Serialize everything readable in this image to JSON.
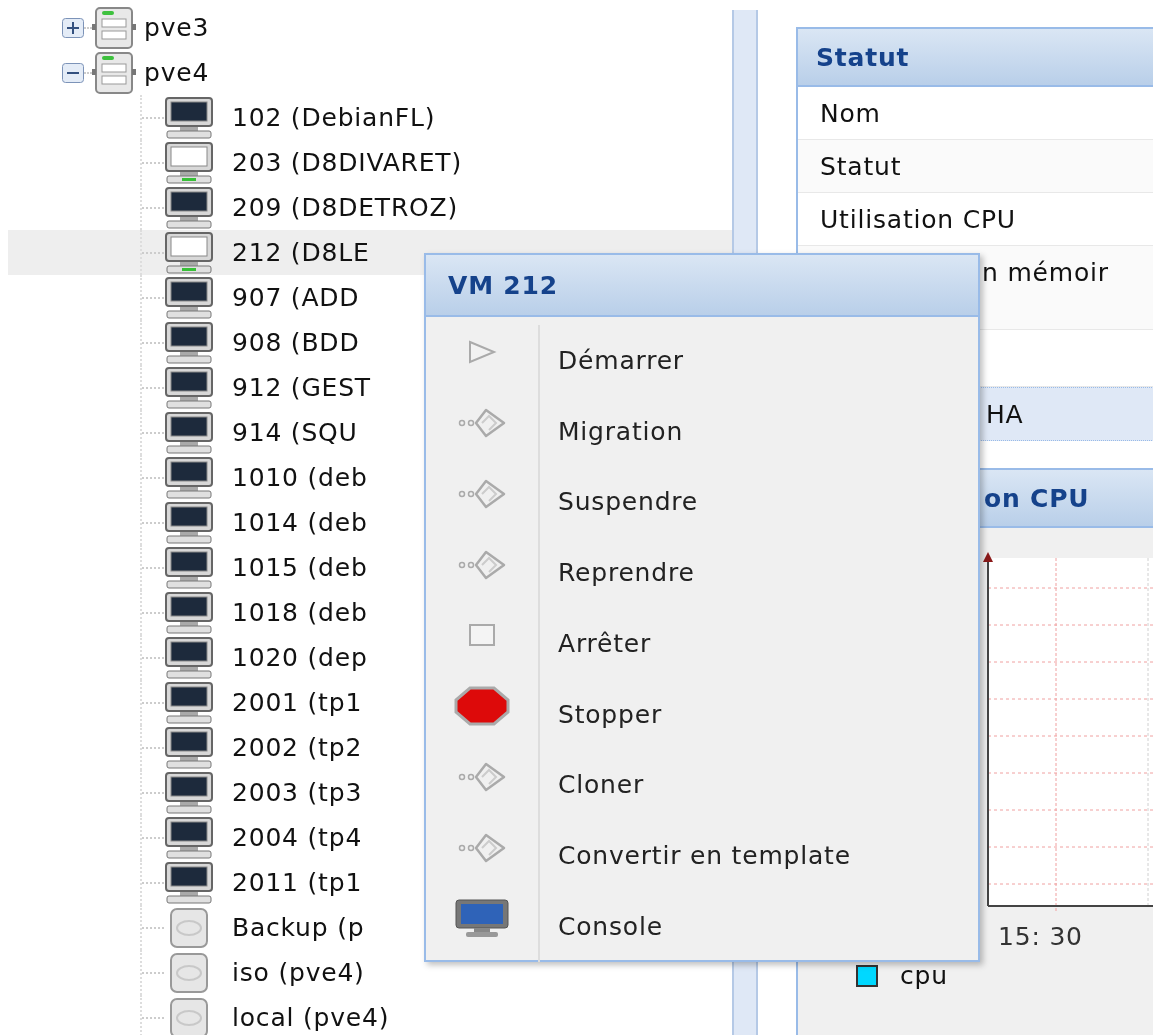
{
  "tree": [
    {
      "label": "pve3",
      "kind": "node",
      "expanded": false
    },
    {
      "label": "pve4",
      "kind": "node",
      "expanded": true,
      "children": [
        {
          "label": "102 (DebianFL)",
          "kind": "vm",
          "running": false,
          "selected": false
        },
        {
          "label": "203 (D8DIVARET)",
          "kind": "vm",
          "running": true,
          "selected": false
        },
        {
          "label": "209 (D8DETROZ)",
          "kind": "vm",
          "running": false,
          "selected": false
        },
        {
          "label": "212 (D8LE",
          "kind": "vm",
          "running": true,
          "selected": true
        },
        {
          "label": "907 (ADD",
          "kind": "vm",
          "running": false,
          "selected": false
        },
        {
          "label": "908 (BDD",
          "kind": "vm",
          "running": false,
          "selected": false
        },
        {
          "label": "912 (GEST",
          "kind": "vm",
          "running": false,
          "selected": false
        },
        {
          "label": "914 (SQU",
          "kind": "vm",
          "running": false,
          "selected": false
        },
        {
          "label": "1010 (deb",
          "kind": "vm",
          "running": false,
          "selected": false
        },
        {
          "label": "1014 (deb",
          "kind": "vm",
          "running": false,
          "selected": false
        },
        {
          "label": "1015 (deb",
          "kind": "vm",
          "running": false,
          "selected": false
        },
        {
          "label": "1018 (deb",
          "kind": "vm",
          "running": false,
          "selected": false
        },
        {
          "label": "1020 (dep",
          "kind": "vm",
          "running": false,
          "selected": false
        },
        {
          "label": "2001 (tp1",
          "kind": "vm",
          "running": false,
          "selected": false
        },
        {
          "label": "2002 (tp2",
          "kind": "vm",
          "running": false,
          "selected": false
        },
        {
          "label": "2003 (tp3",
          "kind": "vm",
          "running": false,
          "selected": false
        },
        {
          "label": "2004 (tp4",
          "kind": "vm",
          "running": false,
          "selected": false
        },
        {
          "label": "2011 (tp1",
          "kind": "vm",
          "running": false,
          "selected": false
        },
        {
          "label": "Backup (p",
          "kind": "storage",
          "selected": false
        },
        {
          "label": "iso (pve4)",
          "kind": "storage",
          "selected": false
        },
        {
          "label": "local (pve4)",
          "kind": "storage",
          "selected": false
        }
      ]
    }
  ],
  "status_panel": {
    "title": "Statut",
    "rows": [
      "Nom",
      "Statut",
      "Utilisation CPU"
    ],
    "partial_row": "n mémoir"
  },
  "ha_row": "HA",
  "cpu_panel": {
    "title": "on CPU",
    "time_label": "15: 30",
    "legend": [
      {
        "label": "cpu",
        "color": "#00d8ff"
      }
    ]
  },
  "context_menu": {
    "title": "VM 212",
    "items": [
      {
        "label": "Démarrer",
        "kind": "start"
      },
      {
        "label": "Migration",
        "kind": "action"
      },
      {
        "label": "Suspendre",
        "kind": "action"
      },
      {
        "label": "Reprendre",
        "kind": "action"
      },
      {
        "label": "Arrêter",
        "kind": "shutdown"
      },
      {
        "label": "Stopper",
        "kind": "stop"
      },
      {
        "label": "Cloner",
        "kind": "action"
      },
      {
        "label": "Convertir en template",
        "kind": "action"
      },
      {
        "label": "Console",
        "kind": "console"
      }
    ]
  }
}
